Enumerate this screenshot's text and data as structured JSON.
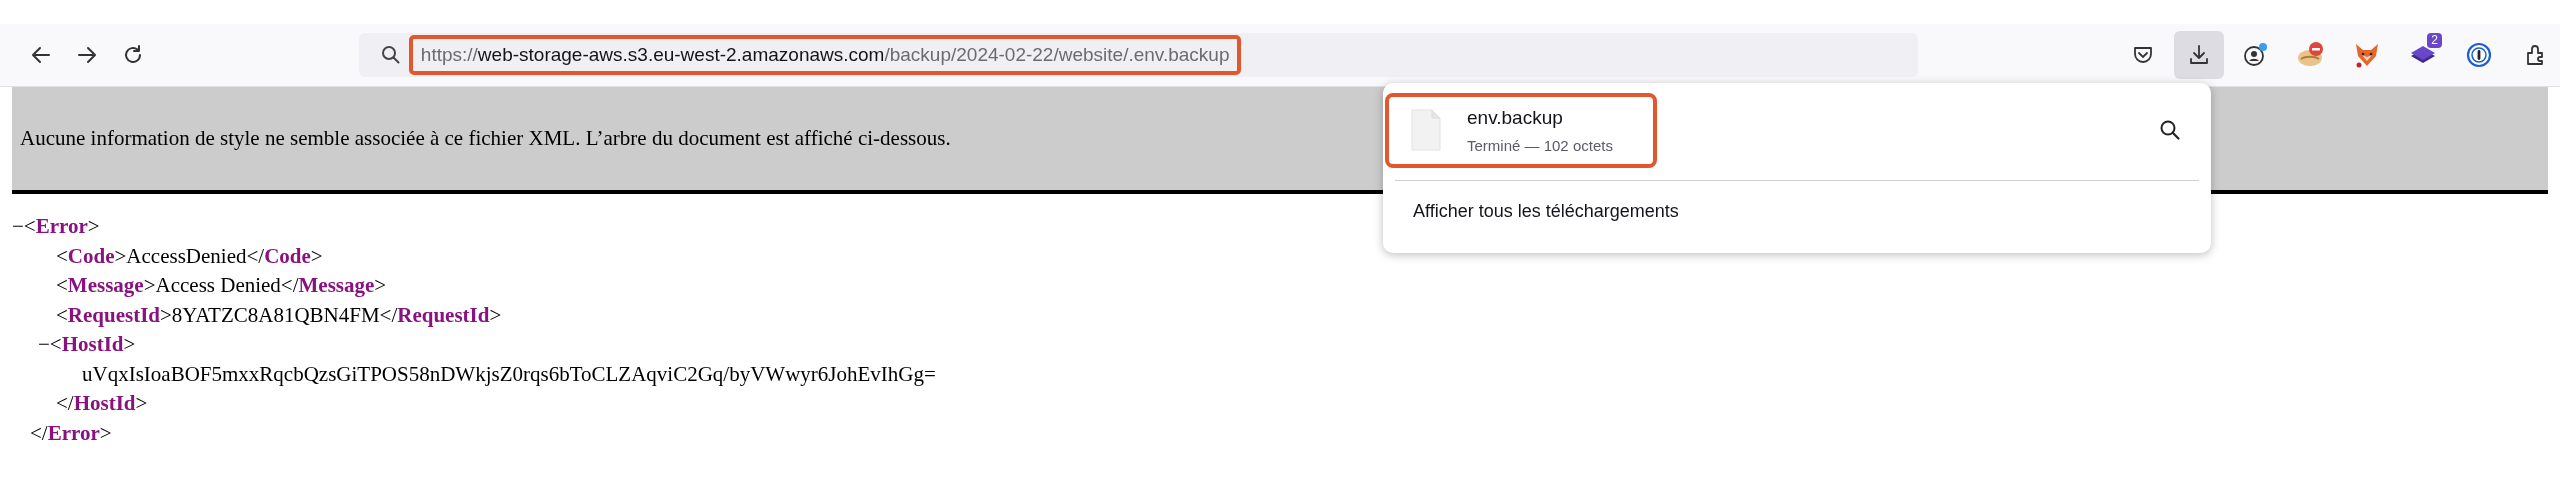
{
  "toolbar": {
    "nav": [
      {
        "kind": "back"
      },
      {
        "kind": "forward"
      },
      {
        "kind": "reload"
      }
    ],
    "url_bar": {
      "scheme": "https://",
      "host": "web-storage-aws.s3.eu-west-2.amazonaws.com",
      "path": "/backup/2024-02-22/website/.env.backup",
      "highlighted": true
    },
    "buttons": [
      {
        "kind": "pocket",
        "pressed": false
      },
      {
        "kind": "downloads",
        "pressed": true
      },
      {
        "kind": "account",
        "pressed": false,
        "notification": true
      },
      {
        "kind": "blocker",
        "pressed": false
      },
      {
        "kind": "fox",
        "pressed": false
      },
      {
        "kind": "layers",
        "pressed": false,
        "badge": "2"
      },
      {
        "kind": "password",
        "pressed": false
      },
      {
        "kind": "extensions",
        "pressed": false
      }
    ]
  },
  "info_bar": {
    "text": "Aucune information de style ne semble associée à ce fichier XML. L’arbre du document est affiché ci-dessous."
  },
  "xml": {
    "toggle": "−",
    "open": "<**Error**>",
    "close": "</**Error**>",
    "children": [
      {
        "line": "<**Code**>AccessDenied</**Code**>"
      },
      {
        "line": "<**Message**>Access Denied</**Message**>"
      },
      {
        "line": "<**RequestId**>8YATZC8A81QBN4FM</**RequestId**>"
      },
      {
        "toggle": "−",
        "open": "<**HostId**>",
        "close": "</**HostId**>",
        "children": [
          {
            "line": "uVqxIsIoaBOF5mxxRqcbQzsGiTPOS58nDWkjsZ0rqs6bToCLZAqviC2Gq/byVWwyr6JohEvIhGg="
          }
        ]
      }
    ]
  },
  "download_panel": {
    "items": [
      {
        "name": "env.backup",
        "status": "Terminé — 102 octets",
        "highlighted": true
      }
    ],
    "footer_link": "Afficher tous les téléchargements"
  }
}
